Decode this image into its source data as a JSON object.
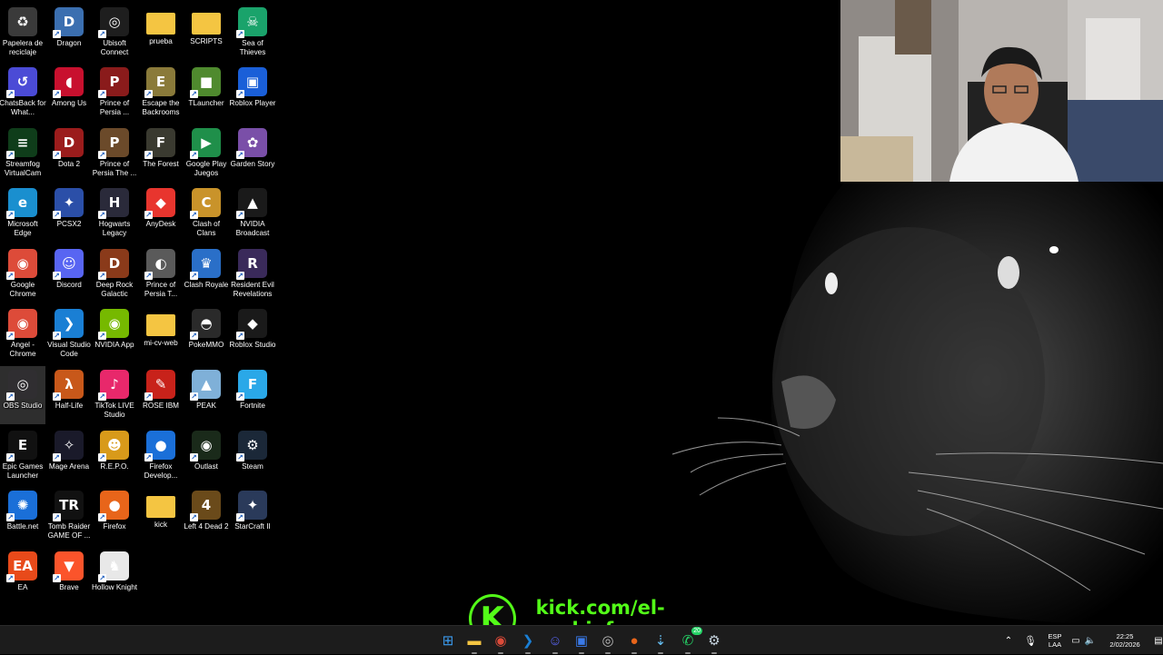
{
  "desktop": {
    "icons": [
      {
        "label": "Papelera de reciclaje",
        "icon": "recycle-bin-icon",
        "color": "#3a3a3a",
        "glyph": "♻"
      },
      {
        "label": "Dragon",
        "icon": "dragon-icon",
        "color": "#3b6fb0",
        "glyph": "D"
      },
      {
        "label": "Ubisoft Connect",
        "icon": "ubisoft-icon",
        "color": "#1e1e1e",
        "glyph": "◎"
      },
      {
        "label": "prueba",
        "icon": "folder-icon",
        "color": "#f4c542",
        "glyph": ""
      },
      {
        "label": "SCRIPTS",
        "icon": "folder-icon",
        "color": "#f4c542",
        "glyph": ""
      },
      {
        "label": "Sea of Thieves",
        "icon": "sea-of-thieves-icon",
        "color": "#1aa36b",
        "glyph": "☠"
      },
      {
        "label": "ChatsBack for What...",
        "icon": "chatsback-icon",
        "color": "#4b4bd6",
        "glyph": "↺"
      },
      {
        "label": "Among Us",
        "icon": "among-us-icon",
        "color": "#c8102e",
        "glyph": "◖"
      },
      {
        "label": "Prince of Persia ...",
        "icon": "prince-of-persia-icon",
        "color": "#8a1b1b",
        "glyph": "P"
      },
      {
        "label": "Escape the Backrooms",
        "icon": "escape-backrooms-icon",
        "color": "#8a7a3a",
        "glyph": "E"
      },
      {
        "label": "TLauncher",
        "icon": "tlauncher-icon",
        "color": "#4f8a2e",
        "glyph": "■"
      },
      {
        "label": "Roblox Player",
        "icon": "roblox-player-icon",
        "color": "#1a5fd8",
        "glyph": "▣"
      },
      {
        "label": "Streamfog VirtualCam",
        "icon": "streamfog-icon",
        "color": "#0f3d1a",
        "glyph": "≡"
      },
      {
        "label": "Dota 2",
        "icon": "dota-icon",
        "color": "#9b1c1c",
        "glyph": "D"
      },
      {
        "label": "Prince of Persia The ...",
        "icon": "prince-of-persia-icon",
        "color": "#6b4a2a",
        "glyph": "P"
      },
      {
        "label": "The Forest",
        "icon": "the-forest-icon",
        "color": "#3a3a30",
        "glyph": "F"
      },
      {
        "label": "Google Play Juegos",
        "icon": "google-play-games-icon",
        "color": "#1f8f4a",
        "glyph": "▶"
      },
      {
        "label": "Garden Story",
        "icon": "garden-story-icon",
        "color": "#7a4fa8",
        "glyph": "✿"
      },
      {
        "label": "Microsoft Edge",
        "icon": "edge-icon",
        "color": "#1a8fcf",
        "glyph": "e"
      },
      {
        "label": "PCSX2",
        "icon": "pcsx2-icon",
        "color": "#2b4fa8",
        "glyph": "✦"
      },
      {
        "label": "Hogwarts Legacy",
        "icon": "hogwarts-legacy-icon",
        "color": "#2a2a3a",
        "glyph": "H"
      },
      {
        "label": "AnyDesk",
        "icon": "anydesk-icon",
        "color": "#e8352e",
        "glyph": "◆"
      },
      {
        "label": "Clash of Clans",
        "icon": "clash-of-clans-icon",
        "color": "#c9932a",
        "glyph": "C"
      },
      {
        "label": "NVIDIA Broadcast",
        "icon": "nvidia-broadcast-icon",
        "color": "#1a1a1a",
        "glyph": "▲"
      },
      {
        "label": "Google Chrome",
        "icon": "chrome-icon",
        "color": "#dd4b39",
        "glyph": "◉"
      },
      {
        "label": "Discord",
        "icon": "discord-icon",
        "color": "#5865f2",
        "glyph": "☺"
      },
      {
        "label": "Deep Rock Galactic",
        "icon": "deep-rock-galactic-icon",
        "color": "#8a3a1a",
        "glyph": "D"
      },
      {
        "label": "Prince of Persia T...",
        "icon": "prince-of-persia-icon",
        "color": "#5a5a5a",
        "glyph": "◐"
      },
      {
        "label": "Clash Royale",
        "icon": "clash-royale-icon",
        "color": "#2a6fc8",
        "glyph": "♛"
      },
      {
        "label": "Resident Evil Revelations",
        "icon": "resident-evil-icon",
        "color": "#3a2a5a",
        "glyph": "R"
      },
      {
        "label": "Angel - Chrome",
        "icon": "chrome-icon",
        "color": "#dd4b39",
        "glyph": "◉"
      },
      {
        "label": "Visual Studio Code",
        "icon": "vscode-icon",
        "color": "#1a7fd4",
        "glyph": "❯"
      },
      {
        "label": "NVIDIA App",
        "icon": "nvidia-app-icon",
        "color": "#76b900",
        "glyph": "◉"
      },
      {
        "label": "mi-cv-web",
        "icon": "folder-icon",
        "color": "#f4c542",
        "glyph": ""
      },
      {
        "label": "PokeMMO",
        "icon": "pokemmo-icon",
        "color": "#2a2a2a",
        "glyph": "◓"
      },
      {
        "label": "Roblox Studio",
        "icon": "roblox-studio-icon",
        "color": "#1a1a1a",
        "glyph": "◆"
      },
      {
        "label": "OBS Studio",
        "icon": "obs-icon",
        "color": "#302e31",
        "glyph": "◎"
      },
      {
        "label": "Half-Life",
        "icon": "half-life-icon",
        "color": "#c8581a",
        "glyph": "λ"
      },
      {
        "label": "TikTok LIVE Studio",
        "icon": "tiktok-live-icon",
        "color": "#e8286b",
        "glyph": "♪"
      },
      {
        "label": "ROSE IBM",
        "icon": "rose-ibm-icon",
        "color": "#c8221a",
        "glyph": "✎"
      },
      {
        "label": "PEAK",
        "icon": "peak-icon",
        "color": "#7fb0d8",
        "glyph": "▲"
      },
      {
        "label": "Fortnite",
        "icon": "fortnite-icon",
        "color": "#2aa8e8",
        "glyph": "F"
      },
      {
        "label": "Epic Games Launcher",
        "icon": "epic-games-icon",
        "color": "#111111",
        "glyph": "E"
      },
      {
        "label": "Mage Arena",
        "icon": "mage-arena-icon",
        "color": "#1a1a2a",
        "glyph": "✧"
      },
      {
        "label": "R.E.P.O.",
        "icon": "repo-icon",
        "color": "#d89a1a",
        "glyph": "☻"
      },
      {
        "label": "Firefox Develop...",
        "icon": "firefox-developer-icon",
        "color": "#1a6fd8",
        "glyph": "●"
      },
      {
        "label": "Outlast",
        "icon": "outlast-icon",
        "color": "#1a2a1a",
        "glyph": "◉"
      },
      {
        "label": "Steam",
        "icon": "steam-icon",
        "color": "#1b2838",
        "glyph": "⚙"
      },
      {
        "label": "Battle.net",
        "icon": "battle-net-icon",
        "color": "#1a6fd8",
        "glyph": "✺"
      },
      {
        "label": "Tomb Raider GAME OF ...",
        "icon": "tomb-raider-icon",
        "color": "#111111",
        "glyph": "TR"
      },
      {
        "label": "Firefox",
        "icon": "firefox-icon",
        "color": "#e8651a",
        "glyph": "●"
      },
      {
        "label": "kick",
        "icon": "folder-icon",
        "color": "#f4c542",
        "glyph": ""
      },
      {
        "label": "Left 4 Dead 2",
        "icon": "left4dead-icon",
        "color": "#6a4a1a",
        "glyph": "4"
      },
      {
        "label": "StarCraft II",
        "icon": "starcraft-icon",
        "color": "#2a3a5a",
        "glyph": "✦"
      },
      {
        "label": "EA",
        "icon": "ea-icon",
        "color": "#e84a1a",
        "glyph": "EA"
      },
      {
        "label": "Brave",
        "icon": "brave-icon",
        "color": "#fb542b",
        "glyph": "▼"
      },
      {
        "label": "Hollow Knight",
        "icon": "hollow-knight-icon",
        "color": "#e8e8e8",
        "glyph": "♞"
      }
    ]
  },
  "overlay": {
    "kick_letter": "K",
    "kick_url": "kick.com/el-cuchiof"
  },
  "taskbar": {
    "apps": [
      {
        "icon": "windows-start-icon",
        "glyph": "⊞",
        "color": "#3b9cf0"
      },
      {
        "icon": "file-explorer-icon",
        "glyph": "▬",
        "color": "#f4c542"
      },
      {
        "icon": "chrome-icon",
        "glyph": "◉",
        "color": "#dd4b39"
      },
      {
        "icon": "vscode-icon",
        "glyph": "❯",
        "color": "#1a7fd4"
      },
      {
        "icon": "discord-icon",
        "glyph": "☺",
        "color": "#5865f2"
      },
      {
        "icon": "app-icon",
        "glyph": "▣",
        "color": "#3a7ae8"
      },
      {
        "icon": "obs-icon",
        "glyph": "◎",
        "color": "#bbbbbb"
      },
      {
        "icon": "firefox-icon",
        "glyph": "●",
        "color": "#e8651a"
      },
      {
        "icon": "steam-streaming-icon",
        "glyph": "⇣",
        "color": "#66c0f4"
      },
      {
        "icon": "whatsapp-icon",
        "glyph": "✆",
        "color": "#25d366",
        "badge": "20"
      },
      {
        "icon": "steam-icon",
        "glyph": "⚙",
        "color": "#c6d4df"
      }
    ],
    "tray": {
      "language_top": "ESP",
      "language_bottom": "LAA",
      "time": "22:25",
      "date": "2/02/2026"
    }
  },
  "colors": {
    "kick_green": "#53fc18",
    "taskbar_bg": "#1c1c1c"
  }
}
